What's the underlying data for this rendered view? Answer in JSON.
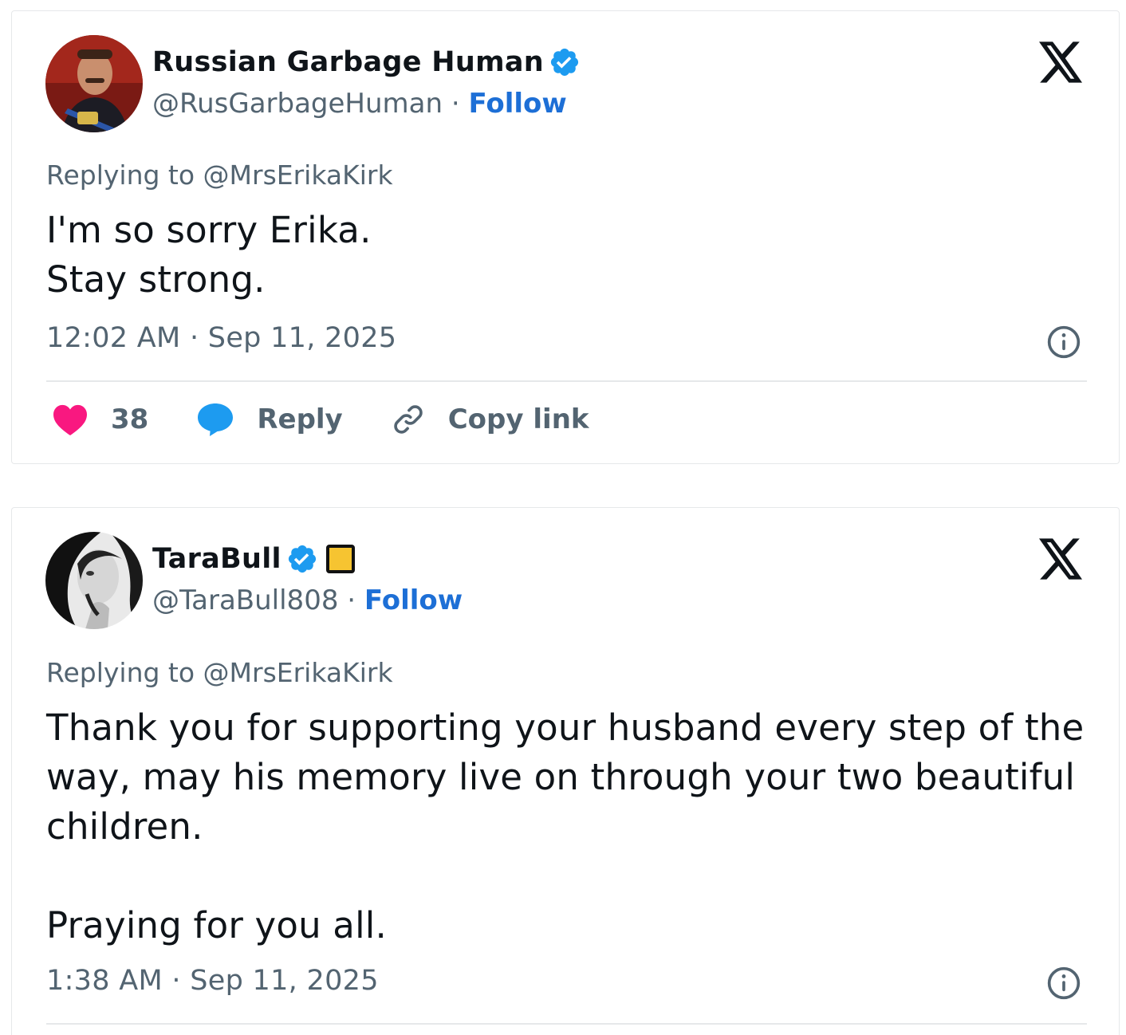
{
  "tweets": [
    {
      "display_name": "Russian Garbage Human",
      "handle": "@RusGarbageHuman",
      "separator": "·",
      "follow_label": "Follow",
      "replying_to": "Replying to @MrsErikaKirk",
      "text": "I'm so sorry Erika.\nStay strong.",
      "timestamp": "12:02 AM · Sep 11, 2025",
      "likes": "38",
      "reply_label": "Reply",
      "copy_link_label": "Copy link"
    },
    {
      "display_name": "TaraBull",
      "handle": "@TaraBull808",
      "separator": "·",
      "follow_label": "Follow",
      "replying_to": "Replying to @MrsErikaKirk",
      "text": "Thank you for supporting your husband every step of the way, may his memory live on through your two beautiful children.\n\nPraying for you all.",
      "timestamp": "1:38 AM · Sep 11, 2025"
    }
  ],
  "colors": {
    "verified": "#1d9bf0",
    "follow": "#1d6fd6",
    "like": "#f91880",
    "reply_bubble": "#1d9bf0",
    "secondary_text": "#536471"
  },
  "icons": [
    "verified-badge-icon",
    "x-logo-icon",
    "info-icon",
    "heart-icon",
    "reply-bubble-icon",
    "link-icon"
  ]
}
